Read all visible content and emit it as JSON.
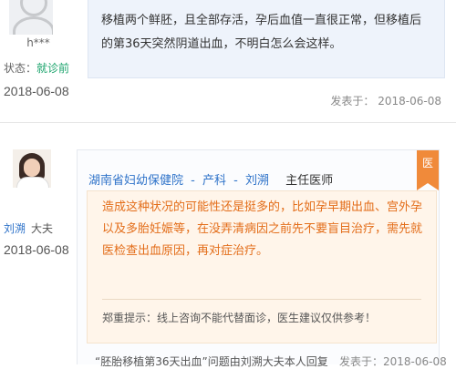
{
  "patient": {
    "username": "h***",
    "status_label": "状态：",
    "status_value": "就诊前",
    "date": "2018-06-08",
    "question": "移植两个鲜胚，且全部存活，孕后血值一直很正常，但移植后的第36天突然阴道出血，不明白怎么会这样。",
    "posted_label": "发表于：",
    "posted_date": "2018-06-08"
  },
  "doctor": {
    "name": "刘溯",
    "role": "大夫",
    "date": "2018-06-08",
    "badge": "医",
    "hospital": "湖南省妇幼保健院",
    "dash1": "-",
    "department": "产科",
    "dash2": "-",
    "header_name": "刘溯",
    "title": "主任医师",
    "reply": "造成这种状况的可能性还是挺多的，比如孕早期出血、宫外孕以及多胎妊娠等，在没弄清病因之前先不要盲目治疗，需先就医检查出血原因，再对症治疗。",
    "tip": "郑重提示：线上咨询不能代替面诊，医生建议仅供参考！"
  },
  "footer": {
    "link_text": "“胚胎移植第36天出血”问题由刘溯大夫本人回复",
    "posted": "发表于：2018-06-08"
  },
  "colors": {
    "link_blue": "#2f73c9",
    "status_green": "#1aa36b",
    "reply_orange": "#e36d19",
    "badge_orange": "#f08a3a"
  },
  "icons": {
    "patient_avatar": "default-user-silhouette",
    "doctor_avatar": "doctor-photo"
  }
}
